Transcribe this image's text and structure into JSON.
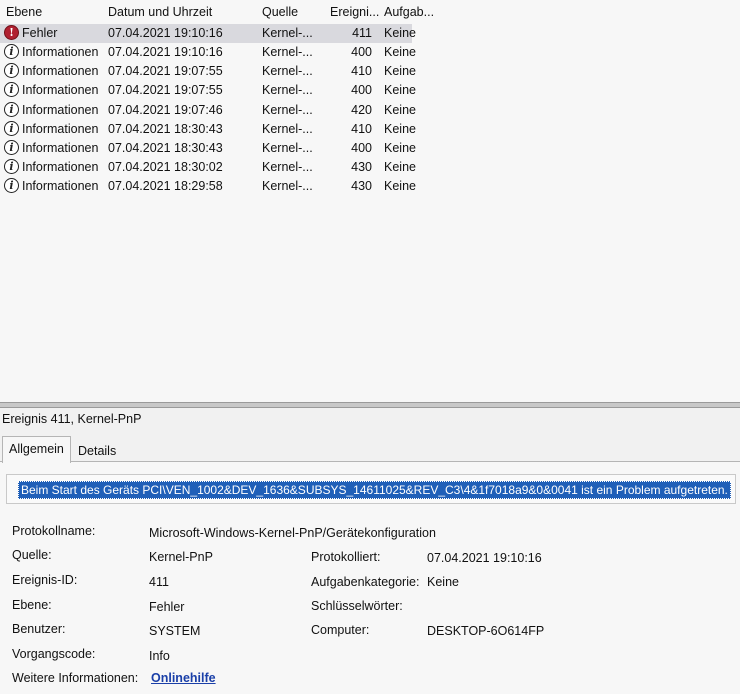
{
  "list": {
    "columns": {
      "level": "Ebene",
      "date": "Datum und Uhrzeit",
      "source": "Quelle",
      "event_id": "Ereigni...",
      "task": "Aufgab..."
    },
    "rows": [
      {
        "level": "Fehler",
        "icon": "error-icon",
        "date": "07.04.2021 19:10:16",
        "source": "Kernel-...",
        "event_id": "411",
        "task": "Keine"
      },
      {
        "level": "Informationen",
        "icon": "info-icon",
        "date": "07.04.2021 19:10:16",
        "source": "Kernel-...",
        "event_id": "400",
        "task": "Keine"
      },
      {
        "level": "Informationen",
        "icon": "info-icon",
        "date": "07.04.2021 19:07:55",
        "source": "Kernel-...",
        "event_id": "410",
        "task": "Keine"
      },
      {
        "level": "Informationen",
        "icon": "info-icon",
        "date": "07.04.2021 19:07:55",
        "source": "Kernel-...",
        "event_id": "400",
        "task": "Keine"
      },
      {
        "level": "Informationen",
        "icon": "info-icon",
        "date": "07.04.2021 19:07:46",
        "source": "Kernel-...",
        "event_id": "420",
        "task": "Keine"
      },
      {
        "level": "Informationen",
        "icon": "info-icon",
        "date": "07.04.2021 18:30:43",
        "source": "Kernel-...",
        "event_id": "410",
        "task": "Keine"
      },
      {
        "level": "Informationen",
        "icon": "info-icon",
        "date": "07.04.2021 18:30:43",
        "source": "Kernel-...",
        "event_id": "400",
        "task": "Keine"
      },
      {
        "level": "Informationen",
        "icon": "info-icon",
        "date": "07.04.2021 18:30:02",
        "source": "Kernel-...",
        "event_id": "430",
        "task": "Keine"
      },
      {
        "level": "Informationen",
        "icon": "info-icon",
        "date": "07.04.2021 18:29:58",
        "source": "Kernel-...",
        "event_id": "430",
        "task": "Keine"
      }
    ]
  },
  "detail": {
    "title": "Ereignis 411, Kernel-PnP",
    "tabs": [
      "Allgemein",
      "Details"
    ],
    "description": "Beim Start des Geräts PCI\\VEN_1002&DEV_1636&SUBSYS_14611025&REV_C3\\4&1f7018a9&0&0041 ist ein Problem aufgetreten.",
    "labels": {
      "log_name": "Protokollname:",
      "source": "Quelle:",
      "event_id": "Ereignis-ID:",
      "level": "Ebene:",
      "user": "Benutzer:",
      "opcode": "Vorgangscode:",
      "more_info": "Weitere Informationen:",
      "logged": "Protokolliert:",
      "task_category": "Aufgabenkategorie:",
      "keywords": "Schlüsselwörter:",
      "computer": "Computer:"
    },
    "values": {
      "log_name": "Microsoft-Windows-Kernel-PnP/Gerätekonfiguration",
      "source": "Kernel-PnP",
      "event_id": "411",
      "level": "Fehler",
      "user": "SYSTEM",
      "opcode": "Info",
      "more_info": "Onlinehilfe",
      "logged": "07.04.2021 19:10:16",
      "task_category": "Keine",
      "keywords": "",
      "computer": "DESKTOP-6O614FP"
    }
  },
  "colors": {
    "selection": "#d9d9de",
    "highlight": "#1f5fb8",
    "error": "#b02030",
    "link": "#1a3fa8"
  }
}
